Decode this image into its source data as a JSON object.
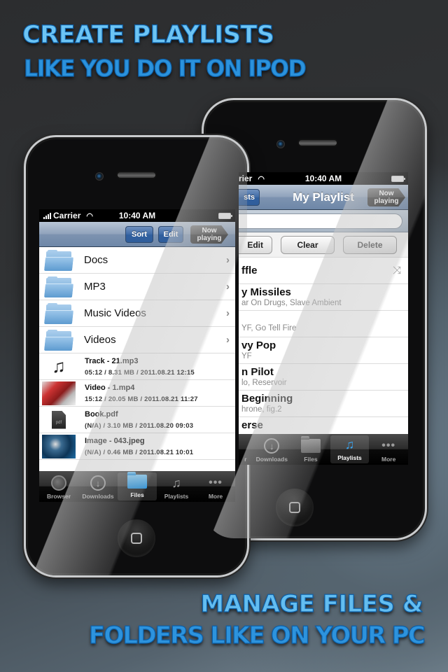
{
  "headlines": {
    "top_line1": "CREATE PLAYLISTS",
    "top_line2": "LIKE YOU DO IT ON IPOD",
    "bottom_line1": "MANAGE FILES &",
    "bottom_line2": "FOLDERS LIKE ON YOUR PC"
  },
  "colors": {
    "headline_light": "#6cc4f4",
    "headline_dark": "#2b92dc",
    "navbar_blue": "#6e87a8",
    "active_tab_blue": "#2a95e0"
  },
  "front_phone": {
    "status": {
      "carrier": "Carrier",
      "time": "10:40 AM",
      "wifi_icon": "wifi-icon",
      "battery_icon": "battery-icon"
    },
    "navbar": {
      "sort": "Sort",
      "edit": "Edit",
      "now_playing_line1": "Now",
      "now_playing_line2": "playing"
    },
    "folders": [
      {
        "name": "Docs",
        "icon": "folder-icon"
      },
      {
        "name": "MP3",
        "icon": "folder-icon"
      },
      {
        "name": "Music Videos",
        "icon": "folder-icon"
      },
      {
        "name": "Videos",
        "icon": "folder-icon"
      }
    ],
    "files": [
      {
        "name": "Track - 21.mp3",
        "meta": "05:12 / 8.31 MB / 2011.08.21 12:15",
        "icon": "music-note-icon"
      },
      {
        "name": "Video - 1.mp4",
        "meta": "15:12 / 20.05 MB / 2011.08.21 11:27",
        "icon": "video-thumbnail"
      },
      {
        "name": "Book.pdf",
        "meta": "(N/A) / 3.10 MB / 2011.08.20 09:03",
        "icon": "pdf-icon",
        "icon_label": "pdf"
      },
      {
        "name": "Image - 043.jpeg",
        "meta": "(N/A) / 0.46 MB / 2011.08.21 10:01",
        "icon": "image-thumbnail"
      }
    ],
    "tabs": [
      {
        "label": "Browser",
        "icon": "globe-icon",
        "active": false
      },
      {
        "label": "Downloads",
        "icon": "download-icon",
        "active": false
      },
      {
        "label": "Files",
        "icon": "folder-icon",
        "active": true
      },
      {
        "label": "Playlists",
        "icon": "playlist-icon",
        "active": false
      },
      {
        "label": "More",
        "icon": "more-dots-icon",
        "active": false
      }
    ]
  },
  "back_phone": {
    "status": {
      "carrier_partial": "rier",
      "time": "10:40 AM"
    },
    "navbar": {
      "back_partial": "sts",
      "title": "My Playlist",
      "now_playing_line1": "Now",
      "now_playing_line2": "playing"
    },
    "search": {
      "value": "",
      "placeholder": ""
    },
    "actions": {
      "edit_partial": "Edit",
      "clear": "Clear",
      "delete": "Delete"
    },
    "shuffle": {
      "label_partial": "ffle",
      "icon": "shuffle-icon"
    },
    "songs": [
      {
        "title_partial": "y Missiles",
        "sub_partial": "ar On Drugs, Slave Ambient"
      },
      {
        "title_partial": "",
        "sub_partial": "YF, Go Tell Fire"
      },
      {
        "title_partial": "vy Pop",
        "sub_partial": "YF"
      },
      {
        "title_partial": "n Pilot",
        "sub_partial": "lo, Reservoir"
      },
      {
        "title_partial": "Beginning",
        "sub_partial": "hrone, fig.2"
      },
      {
        "title_partial": "erse",
        "sub_partial": ""
      }
    ],
    "tabs": [
      {
        "label": "r",
        "icon": "",
        "active": false
      },
      {
        "label": "Downloads",
        "icon": "download-icon",
        "active": false
      },
      {
        "label": "Files",
        "icon": "folder-icon",
        "active": false
      },
      {
        "label": "Playlists",
        "icon": "playlist-icon",
        "active": true
      },
      {
        "label": "More",
        "icon": "more-dots-icon",
        "active": false
      }
    ],
    "playlist_glyph": "♫",
    "download_glyph": "↓",
    "more_glyph": "•••",
    "chevron_glyph": "›",
    "shuffle_glyph": "⤨"
  }
}
